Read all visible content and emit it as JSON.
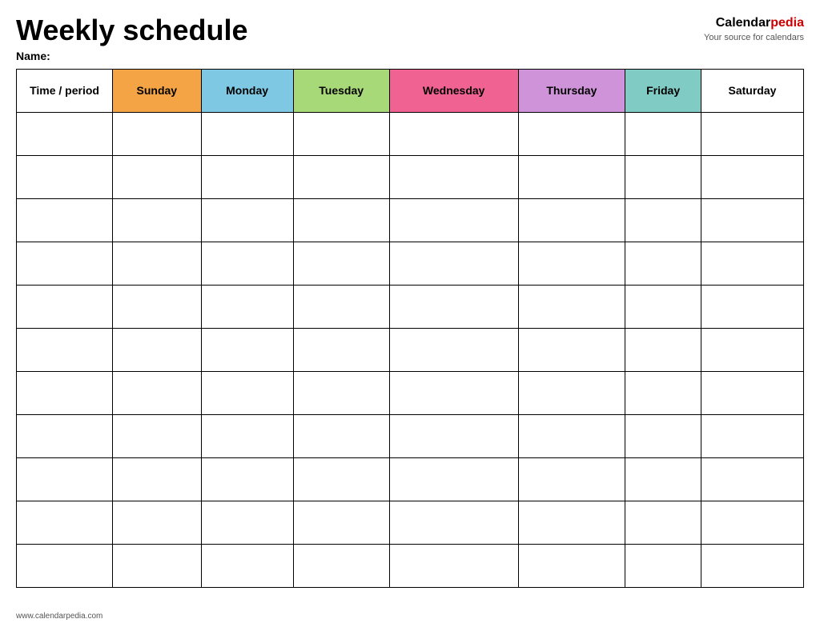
{
  "header": {
    "title": "Weekly schedule",
    "name_label": "Name:",
    "brand_calendar": "Calendar",
    "brand_pedia": "pedia",
    "brand_tagline": "Your source for calendars"
  },
  "table": {
    "columns": [
      {
        "key": "time",
        "label": "Time / period",
        "color_class": "col-time"
      },
      {
        "key": "sunday",
        "label": "Sunday",
        "color_class": "col-sunday"
      },
      {
        "key": "monday",
        "label": "Monday",
        "color_class": "col-monday"
      },
      {
        "key": "tuesday",
        "label": "Tuesday",
        "color_class": "col-tuesday"
      },
      {
        "key": "wednesday",
        "label": "Wednesday",
        "color_class": "col-wednesday"
      },
      {
        "key": "thursday",
        "label": "Thursday",
        "color_class": "col-thursday"
      },
      {
        "key": "friday",
        "label": "Friday",
        "color_class": "col-friday"
      },
      {
        "key": "saturday",
        "label": "Saturday",
        "color_class": "col-saturday"
      }
    ],
    "row_count": 11
  },
  "footer": {
    "url": "www.calendarpedia.com"
  }
}
